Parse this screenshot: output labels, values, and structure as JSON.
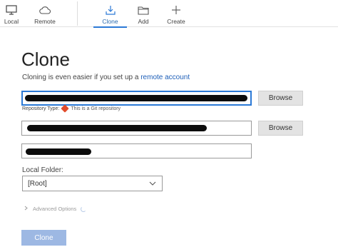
{
  "toolbar": {
    "items": [
      {
        "label": "Local",
        "icon": "monitor-icon"
      },
      {
        "label": "Remote",
        "icon": "cloud-icon"
      },
      {
        "label": "Clone",
        "icon": "download-icon",
        "active": true
      },
      {
        "label": "Add",
        "icon": "folder-icon"
      },
      {
        "label": "Create",
        "icon": "plus-icon"
      }
    ]
  },
  "main": {
    "title": "Clone",
    "subtitle_prefix": "Cloning is even easier if you set up a ",
    "subtitle_link": "remote account",
    "source_field": {
      "value": "[redacted]"
    },
    "browse_label_1": "Browse",
    "repo_type_label": "Repository Type:",
    "repo_type_value": "This is a Git repository",
    "destination_field": {
      "value": "[redacted]"
    },
    "browse_label_2": "Browse",
    "name_field": {
      "value": "[redacted]"
    },
    "local_folder_label": "Local Folder:",
    "local_folder_value": "[Root]",
    "advanced_label": "Advanced Options",
    "clone_button_label": "Clone"
  },
  "colors": {
    "accent": "#2b79d6",
    "link": "#1e5fb8",
    "primary_button": "#9db8e3",
    "git_badge": "#e24b2b"
  }
}
